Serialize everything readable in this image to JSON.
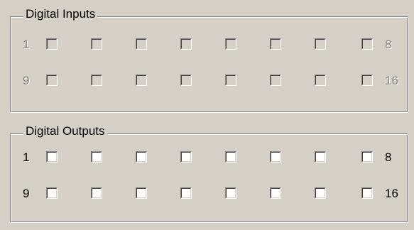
{
  "digital_inputs": {
    "title": "Digital Inputs",
    "enabled": false,
    "rows": [
      {
        "start_label": "1",
        "end_label": "8",
        "checked": [
          false,
          false,
          false,
          false,
          false,
          false,
          false,
          false
        ]
      },
      {
        "start_label": "9",
        "end_label": "16",
        "checked": [
          false,
          false,
          false,
          false,
          false,
          false,
          false,
          false
        ]
      }
    ]
  },
  "digital_outputs": {
    "title": "Digital Outputs",
    "enabled": true,
    "rows": [
      {
        "start_label": "1",
        "end_label": "8",
        "checked": [
          false,
          false,
          false,
          false,
          false,
          false,
          false,
          false
        ]
      },
      {
        "start_label": "9",
        "end_label": "16",
        "checked": [
          false,
          false,
          false,
          false,
          false,
          false,
          false,
          false
        ]
      }
    ]
  },
  "colors": {
    "face": "#d4d0c8",
    "shadow": "#808080",
    "highlight": "#ffffff",
    "checkbox_enabled_bg": "#ffffff"
  }
}
